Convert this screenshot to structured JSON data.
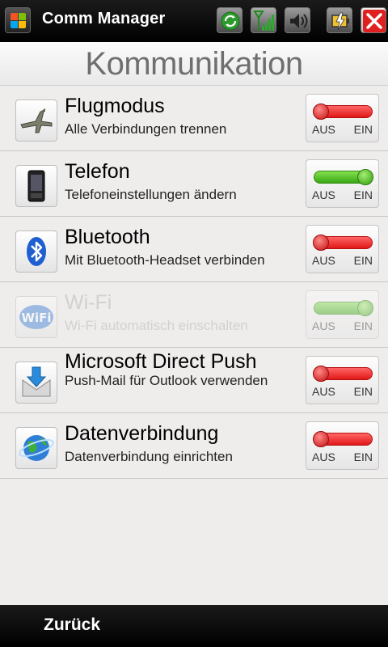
{
  "titlebar": {
    "app_title": "Comm Manager",
    "icons": [
      "windows-start-icon",
      "sync-icon",
      "signal-icon",
      "sound-icon",
      "battery-icon",
      "close-icon"
    ]
  },
  "header": {
    "title": "Kommunikation"
  },
  "rows": [
    {
      "title": "Flugmodus",
      "subtitle": "Alle Verbindungen trennen",
      "icon": "airplane-icon",
      "state": "off",
      "enabled": true,
      "off_label": "AUS",
      "on_label": "EIN"
    },
    {
      "title": "Telefon",
      "subtitle": "Telefoneinstellungen ändern",
      "icon": "phone-icon",
      "state": "on",
      "enabled": true,
      "off_label": "AUS",
      "on_label": "EIN"
    },
    {
      "title": "Bluetooth",
      "subtitle": "Mit Bluetooth-Headset verbinden",
      "icon": "bluetooth-icon",
      "state": "off",
      "enabled": true,
      "off_label": "AUS",
      "on_label": "EIN"
    },
    {
      "title": "Wi-Fi",
      "subtitle": "Wi-Fi automatisch einschalten",
      "icon": "wifi-icon",
      "state": "on",
      "enabled": false,
      "off_label": "AUS",
      "on_label": "EIN"
    },
    {
      "title": "Microsoft Direct Push",
      "subtitle": "Push-Mail für Outlook verwenden",
      "icon": "push-mail-icon",
      "state": "off",
      "enabled": true,
      "off_label": "AUS",
      "on_label": "EIN"
    },
    {
      "title": "Datenverbindung",
      "subtitle": "Datenverbindung einrichten",
      "icon": "globe-icon",
      "state": "off",
      "enabled": true,
      "off_label": "AUS",
      "on_label": "EIN"
    }
  ],
  "bottombar": {
    "back_label": "Zurück"
  },
  "colors": {
    "off": "#e01818",
    "on": "#38a714",
    "title_gray": "#6f6f6f"
  }
}
